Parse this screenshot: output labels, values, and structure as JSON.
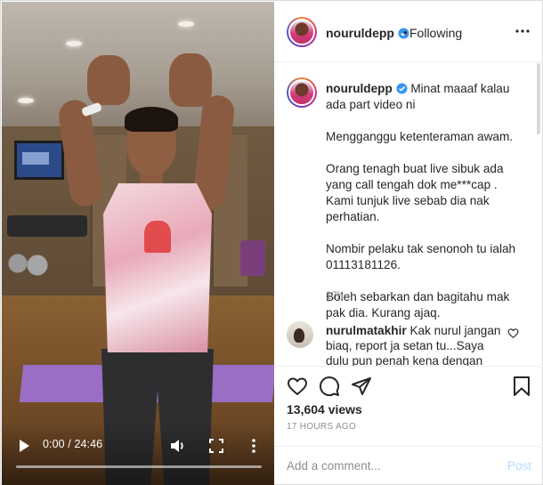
{
  "video": {
    "time": "0:00 / 24:46",
    "progress": 0.0,
    "icons": [
      "play-icon",
      "volume-icon",
      "fullscreen-icon",
      "more-vertical-icon"
    ]
  },
  "header": {
    "username": "nouruldepp",
    "separator": "•",
    "follow_status": "Following",
    "icons": [
      "verified-badge-icon",
      "more-horizontal-icon"
    ]
  },
  "caption": {
    "username": "nouruldepp",
    "paragraphs": [
      "Minat maaaf kalau ada part video ni",
      "Mengganggu ketenteraman awam.",
      "Orang tenagh buat live sibuk ada yang call tengah dok me***cap . Kami tunjuk live sebab dia nak perhatian.",
      "Nombir pelaku tak senonoh tu ialah 01113181126.",
      "Boleh sebarkan dan bagitahu mak pak dia. Kurang ajaq."
    ],
    "time": "17h"
  },
  "comments": [
    {
      "username": "nurulmatakhir",
      "text": "Kak nurul jangan biaq, report ja setan tu...Saya dulu pun penah kena dengan jiran"
    }
  ],
  "stats": {
    "views": "13,604 views",
    "posted": "17 HOURS AGO"
  },
  "add_comment": {
    "placeholder": "Add a comment...",
    "post_label": "Post"
  },
  "colors": {
    "verified": "#3897f0",
    "link_disabled": "#b3dbff",
    "muted": "#8e8e8e",
    "text": "#262626"
  }
}
